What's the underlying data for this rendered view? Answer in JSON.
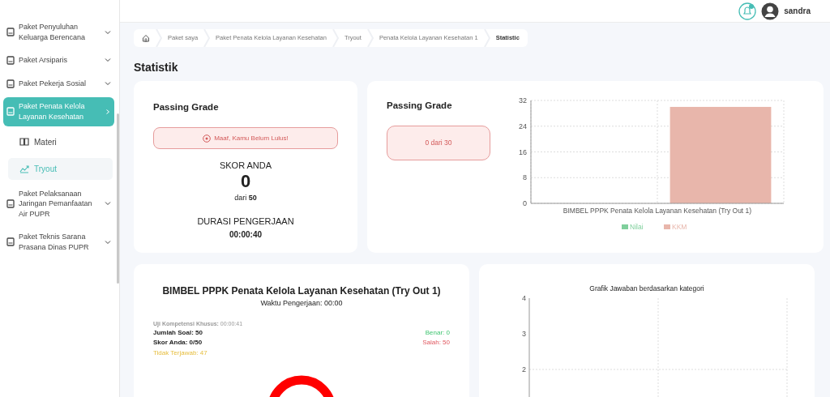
{
  "topbar": {
    "user": "sandra"
  },
  "sidebar": {
    "items": [
      {
        "label": "Paket Penyuluhan Keluarga Berencana",
        "expanded": false,
        "selected": false
      },
      {
        "label": "Paket Arsiparis",
        "expanded": false,
        "selected": false
      },
      {
        "label": "Paket Pekerja Sosial",
        "expanded": false,
        "selected": false
      },
      {
        "label": "Paket Penata Kelola Layanan Kesehatan",
        "expanded": true,
        "selected": true,
        "children": [
          {
            "label": "Materi",
            "kind": "book",
            "selected": false
          },
          {
            "label": "Tryout",
            "kind": "chart",
            "selected": true
          }
        ]
      },
      {
        "label": "Paket Pelaksanaan Jaringan Pemanfaatan Air PUPR",
        "expanded": false,
        "selected": false
      },
      {
        "label": "Paket Teknis Sarana Prasana Dinas PUPR",
        "expanded": false,
        "selected": false
      }
    ]
  },
  "breadcrumb": [
    "Paket saya",
    "Paket Penata Kelola Layanan Kesehatan",
    "Tryout",
    "Penata Kelola Layanan Kesehatan 1",
    "Statistic"
  ],
  "page_title": "Statistik",
  "result_card": {
    "title": "Passing Grade",
    "passed": false,
    "alert": "Maaf, Kamu Belum Lulus!",
    "score_label": "SKOR ANDA",
    "score": "0",
    "score_total": "dari **50**",
    "duration_label": "DURASI PENGERJAAN",
    "duration": "00:00:40"
  },
  "passing_card": {
    "title": "Passing Grade",
    "summary": "0 dari 30",
    "chart_data": {
      "type": "bar",
      "categories": [
        "BIMBEL PPPK Penata Kelola Layanan Kesehatan (Try Out 1)"
      ],
      "series": [
        {
          "name": "Nilai",
          "color": "#7fcf9c",
          "values": [
            0
          ]
        },
        {
          "name": "KKM",
          "color": "#e8b6ab",
          "values": [
            30
          ]
        }
      ],
      "ylim": [
        0,
        32
      ],
      "yticks": [
        0,
        8,
        16,
        24,
        32
      ],
      "grid": true
    }
  },
  "summary_card": {
    "title": "BIMBEL PPPK Penata Kelola Layanan Kesehatan (Try Out 1)",
    "time": "Waktu Pengerjaan: 00:00",
    "section": "**Uji Kompetensi Khusus:** 00:00:41",
    "left": [
      {
        "text": "Jumlah Soal: 50",
        "kind": "total"
      },
      {
        "text": "Skor Anda: 0/50",
        "kind": "total"
      },
      {
        "text": "Tidak Terjawab: 47",
        "kind": "unanswered"
      }
    ],
    "right": [
      {
        "text": "Benar: 0",
        "kind": "correct"
      },
      {
        "text": "Salah: 50",
        "kind": "wrong"
      }
    ]
  },
  "category_card": {
    "title": "Grafik Jawaban berdasarkan kategori",
    "y_axis_labels": [
      "4",
      "3",
      "2"
    ]
  }
}
